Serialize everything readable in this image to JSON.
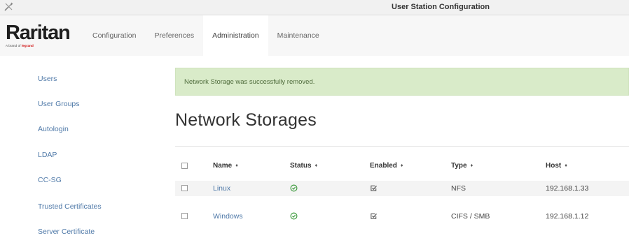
{
  "window": {
    "title": "User Station Configuration",
    "icon": "tools-icon"
  },
  "header": {
    "logo": {
      "brand": "Raritan",
      "tagline_prefix": "A brand of",
      "tagline_brand": "legrand"
    },
    "tabs": [
      {
        "label": "Configuration",
        "active": false
      },
      {
        "label": "Preferences",
        "active": false
      },
      {
        "label": "Administration",
        "active": true
      },
      {
        "label": "Maintenance",
        "active": false
      }
    ]
  },
  "sidebar": {
    "items": [
      {
        "label": "Users"
      },
      {
        "label": "User Groups"
      },
      {
        "label": "Autologin"
      },
      {
        "label": "LDAP"
      },
      {
        "label": "CC-SG"
      },
      {
        "label": "Trusted Certificates"
      },
      {
        "label": "Server Certificate"
      }
    ]
  },
  "main": {
    "alert": "Network Storage was successfully removed.",
    "title": "Network Storages",
    "table": {
      "sort_icon": "sort-icon",
      "columns": [
        "Name",
        "Status",
        "Enabled",
        "Type",
        "Host"
      ],
      "rows": [
        {
          "name": "Linux",
          "status_icon": "check-circle-icon",
          "enabled_icon": "checked-box-icon",
          "type": "NFS",
          "host": "192.168.1.33"
        },
        {
          "name": "Windows",
          "status_icon": "check-circle-icon",
          "enabled_icon": "checked-box-icon",
          "type": "CIFS / SMB",
          "host": "192.168.1.12"
        }
      ]
    }
  },
  "colors": {
    "link": "#4f79a8",
    "status_ok": "#3c9a3c",
    "alert_bg": "#d9ebc9",
    "alert_text": "#4e6b3b"
  }
}
